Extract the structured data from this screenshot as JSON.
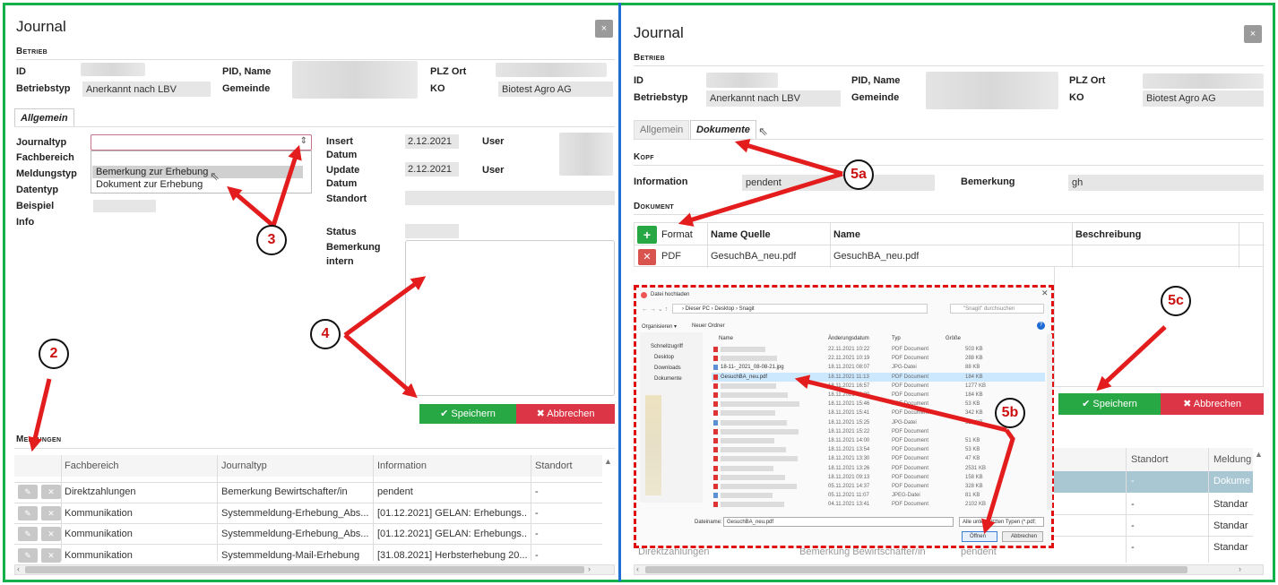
{
  "left": {
    "title": "Journal",
    "close": "×",
    "betrieb_title": "Betrieb",
    "labels": {
      "id": "ID",
      "betriebstyp": "Betriebstyp",
      "pid": "PID, Name",
      "gemeinde": "Gemeinde",
      "plz": "PLZ Ort",
      "ko": "KO"
    },
    "values": {
      "betriebstyp": "Anerkannt nach LBV",
      "ko": "Biotest Agro AG"
    },
    "tab_allgemein": "Allgemein",
    "form_labels": {
      "journaltyp": "Journaltyp",
      "fachbereich": "Fachbereich",
      "meldungstyp": "Meldungstyp",
      "datentyp": "Datentyp",
      "beispiel": "Beispiel",
      "info": "Info"
    },
    "dropdown_options": [
      "Bemerkung zur Erhebung",
      "Dokument zur Erhebung"
    ],
    "right_labels": {
      "insert": "Insert",
      "datum1": "Datum",
      "update": "Update",
      "datum2": "Datum",
      "standort": "Standort",
      "user1": "User",
      "user2": "User",
      "status": "Status",
      "bemerkung": "Bemerkung",
      "intern": "intern"
    },
    "insert_value": "2.12.2021",
    "update_value": "2.12.2021",
    "save": "✔ Speichern",
    "cancel": "✖ Abbrechen",
    "meldungen_title": "Meldungen",
    "table_headers": [
      "Fachbereich",
      "Journaltyp",
      "Information",
      "Standort"
    ],
    "rows": [
      [
        "Direktzahlungen",
        "Bemerkung Bewirtschafter/in",
        "pendent",
        "-"
      ],
      [
        "Kommunikation",
        "Systemmeldung-Erhebung_Abs...",
        "[01.12.2021] GELAN: Erhebungs...",
        "-"
      ],
      [
        "Kommunikation",
        "Systemmeldung-Erhebung_Abs...",
        "[01.12.2021] GELAN: Erhebungs...",
        "-"
      ],
      [
        "Kommunikation",
        "Systemmeldung-Mail-Erhebung",
        "[31.08.2021] Herbsterhebung 20...",
        "-"
      ]
    ],
    "annotations": {
      "a2": "2",
      "a3": "3",
      "a4": "4"
    }
  },
  "right": {
    "title": "Journal",
    "close": "×",
    "betrieb_title": "Betrieb",
    "labels": {
      "id": "ID",
      "betriebstyp": "Betriebstyp",
      "pid": "PID, Name",
      "gemeinde": "Gemeinde",
      "plz": "PLZ Ort",
      "ko": "KO"
    },
    "values": {
      "betriebstyp": "Anerkannt nach LBV",
      "ko": "Biotest Agro AG"
    },
    "tab_allgemein": "Allgemein",
    "tab_dokumente": "Dokumente",
    "kopf_title": "Kopf",
    "information_label": "Information",
    "information_value": "pendent",
    "bemerkung_label": "Bemerkung",
    "bemerkung_value": "gh",
    "dokument_title": "Dokument",
    "doc_headers": [
      "Format",
      "Name Quelle",
      "Name",
      "Beschreibung"
    ],
    "doc_row": [
      "PDF",
      "GesuchBA_neu.pdf",
      "GesuchBA_neu.pdf",
      ""
    ],
    "save": "✔ Speichern",
    "cancel": "✖ Abbrechen",
    "table_headers": [
      "Standort",
      "Meldung"
    ],
    "bg_rows": [
      [
        "-",
        "Dokume"
      ],
      [
        "-",
        "Standar"
      ],
      [
        "-",
        "Standar"
      ],
      [
        "-",
        "Standar"
      ]
    ],
    "bg_row_left": [
      "Direktzahlungen",
      "Bemerkung Bewirtschafter/in",
      "pendent"
    ],
    "annotations": {
      "a5a": "5a",
      "a5b": "5b",
      "a5c": "5c"
    }
  },
  "dialog": {
    "title": "Datei hochladen",
    "path": "› Dieser PC › Desktop › Snagit",
    "search": "\"Snagit\" durchsuchen",
    "organize": "Organisieren ▾",
    "new_folder": "Neuer Ordner",
    "col_name": "Name",
    "col_date": "Änderungsdatum",
    "col_type": "Typ",
    "col_size": "Größe",
    "sidebar": [
      "Schnellzugriff",
      "Desktop",
      "Downloads",
      "Dokumente"
    ],
    "files": [
      {
        "name": "",
        "date": "22.11.2021 10:22",
        "type": "PDF Document",
        "size": "503 KB"
      },
      {
        "name": "",
        "date": "22.11.2021 10:19",
        "type": "PDF Document",
        "size": "288 KB"
      },
      {
        "name": "18-11-_2021_08-08-21.jpg",
        "date": "18.11.2021 08:07",
        "type": "JPG-Datei",
        "size": "88 KB"
      },
      {
        "name": "GesuchBA_neu.pdf",
        "date": "18.11.2021 11:13",
        "type": "PDF Document",
        "size": "184 KB"
      },
      {
        "name": "",
        "date": "18.11.2021 16:57",
        "type": "PDF Document",
        "size": "1277 KB"
      },
      {
        "name": "",
        "date": "18.11.2021 16:30",
        "type": "PDF Document",
        "size": "184 KB"
      },
      {
        "name": "",
        "date": "18.11.2021 15:46",
        "type": "PDF Document",
        "size": "53 KB"
      },
      {
        "name": "",
        "date": "18.11.2021 15:41",
        "type": "PDF Document",
        "size": "342 KB"
      },
      {
        "name": "",
        "date": "18.11.2021 15:25",
        "type": "JPG-Datei",
        "size": "538 KB"
      },
      {
        "name": "",
        "date": "18.11.2021 15:22",
        "type": "PDF Document",
        "size": ""
      },
      {
        "name": "",
        "date": "18.11.2021 14:00",
        "type": "PDF Document",
        "size": "51 KB"
      },
      {
        "name": "",
        "date": "18.11.2021 13:54",
        "type": "PDF Document",
        "size": "53 KB"
      },
      {
        "name": "",
        "date": "18.11.2021 13:30",
        "type": "PDF Document",
        "size": "47 KB"
      },
      {
        "name": "",
        "date": "18.11.2021 13:26",
        "type": "PDF Document",
        "size": "2531 KB"
      },
      {
        "name": "",
        "date": "18.11.2021 09:13",
        "type": "PDF Document",
        "size": "158 KB"
      },
      {
        "name": "",
        "date": "05.11.2021 14:37",
        "type": "PDF Document",
        "size": "328 KB"
      },
      {
        "name": "",
        "date": "05.11.2021 11:07",
        "type": "JPEG-Datei",
        "size": "81 KB"
      },
      {
        "name": "",
        "date": "04.11.2021 13:41",
        "type": "PDF Document",
        "size": "2102 KB"
      }
    ],
    "filename_label": "Dateiname:",
    "filename_value": "GesuchBA_neu.pdf",
    "filetype": "Alle unterstützten Typen (*.pdf;",
    "open": "Öffnen",
    "cancel": "Abbrechen"
  }
}
